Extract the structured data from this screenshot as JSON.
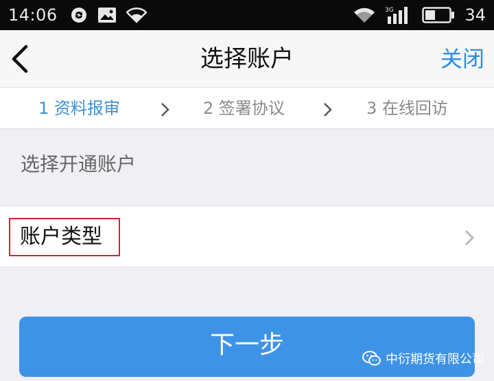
{
  "status_bar": {
    "time": "14:06",
    "network_label": "3G",
    "battery_level": "34",
    "icons": [
      "sync-icon",
      "image-notification-icon",
      "wifi-icon",
      "wifi-icon",
      "cellular-signal-icon",
      "battery-icon"
    ]
  },
  "nav": {
    "title": "选择账户",
    "close_label": "关闭",
    "back_icon": "chevron-left-icon"
  },
  "steps": [
    {
      "label": "1 资料报审",
      "active": true
    },
    {
      "label": "2 签署协议",
      "active": false
    },
    {
      "label": "3 在线回访",
      "active": false
    }
  ],
  "section": {
    "label": "选择开通账户"
  },
  "account_row": {
    "label": "账户类型",
    "highlight_color": "#c5282f"
  },
  "next_button": {
    "label": "下一步"
  },
  "watermark": {
    "text": "中衍期货有限公司",
    "icon": "wechat-icon"
  },
  "colors": {
    "accent": "#2a8ee3",
    "button": "#3e93e6",
    "background": "#efeff4"
  }
}
